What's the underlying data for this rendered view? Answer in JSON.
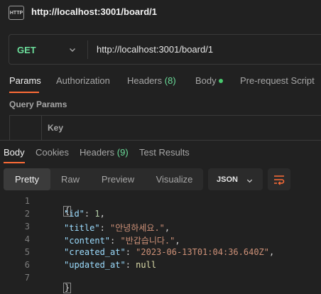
{
  "title_bar": {
    "badge": "HTTP",
    "request_name": "http://localhost:3001/board/1"
  },
  "request": {
    "method": "GET",
    "url": "http://localhost:3001/board/1"
  },
  "request_tabs": [
    {
      "label": "Params",
      "count": "",
      "active": true
    },
    {
      "label": "Authorization",
      "count": ""
    },
    {
      "label": "Headers",
      "count": "(8)"
    },
    {
      "label": "Body",
      "count": "",
      "has_dot": true
    },
    {
      "label": "Pre-request Script",
      "count": ""
    }
  ],
  "query_params": {
    "section_label": "Query Params",
    "column_key": "Key"
  },
  "response_tabs": [
    {
      "label": "Body",
      "count": "",
      "active": true
    },
    {
      "label": "Cookies",
      "count": ""
    },
    {
      "label": "Headers",
      "count": "(9)"
    },
    {
      "label": "Test Results",
      "count": ""
    }
  ],
  "view_modes": [
    "Pretty",
    "Raw",
    "Preview",
    "Visualize"
  ],
  "active_view_mode": "Pretty",
  "format": "JSON",
  "line_numbers": [
    "1",
    "2",
    "3",
    "4",
    "5",
    "6",
    "7"
  ],
  "response_body": {
    "open_brace": "{",
    "close_brace": "}",
    "fields": [
      {
        "key": "\"id\"",
        "value": "1",
        "type": "number",
        "comma": ","
      },
      {
        "key": "\"title\"",
        "value": "\"안녕하세요.\"",
        "type": "string",
        "comma": ","
      },
      {
        "key": "\"content\"",
        "value": "\"반갑습니다.\"",
        "type": "string",
        "comma": ","
      },
      {
        "key": "\"created_at\"",
        "value": "\"2023-06-13T01:04:36.640Z\"",
        "type": "string",
        "comma": ","
      },
      {
        "key": "\"updated_at\"",
        "value": "null",
        "type": "null",
        "comma": ""
      }
    ]
  },
  "colors": {
    "background": "#212121",
    "accent": "#ff6c37",
    "method_get": "#6bdd9a",
    "json_key": "#9cdcfe",
    "json_string": "#ce9178",
    "json_number": "#b5cea8"
  }
}
